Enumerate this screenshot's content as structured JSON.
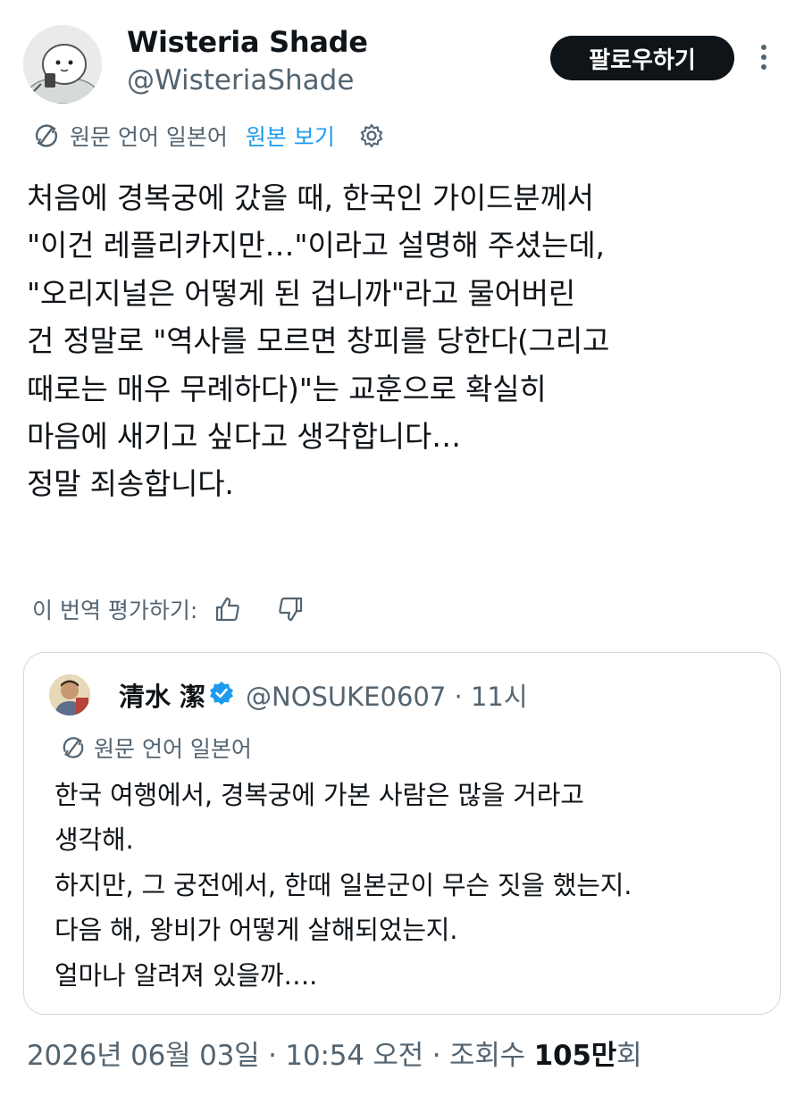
{
  "author": {
    "display_name": "Wisteria Shade",
    "handle": "@WisteriaShade",
    "avatar_icon": "cartoon-character-avatar"
  },
  "actions": {
    "follow_label": "팔로우하기",
    "more_icon": "more-vertical-icon"
  },
  "translation": {
    "source_language_label": "원문 언어 일본어",
    "show_original_label": "원본 보기",
    "settings_icon": "gear-icon",
    "rate_label": "이 번역 평가하기:",
    "thumbs_up_icon": "thumbs-up-icon",
    "thumbs_down_icon": "thumbs-down-icon"
  },
  "tweet": {
    "lines": [
      "처음에 경복궁에 갔을 때, 한국인 가이드분께서",
      "\"이건 레플리카지만…\"이라고 설명해 주셨는데,",
      "\"오리지널은 어떻게 된 겁니까\"라고 물어버린",
      "건 정말로 \"역사를 모르면 창피를 당한다(그리고",
      "때로는 매우 무례하다)\"는 교훈으로 확실히",
      "마음에 새기고 싶다고 생각합니다…",
      "정말 죄송합니다."
    ]
  },
  "quoted_tweet": {
    "display_name": "清水 潔",
    "verified_icon": "verified-badge-icon",
    "handle_time": "@NOSUKE0607 · 11시",
    "source_language_label": "원문 언어 일본어",
    "lines": [
      "한국 여행에서, 경복궁에 가본 사람은 많을 거라고",
      "생각해.",
      "하지만, 그 궁전에서, 한때 일본군이 무슨 짓을 했는지.",
      "다음 해, 왕비가 어떻게 살해되었는지.",
      "얼마나 알려져 있을까…."
    ]
  },
  "meta": {
    "date_time": "2026년 06월 03일 · 10:54 오전 · 조회수 ",
    "views_number": "105만",
    "views_suffix": "회"
  },
  "colors": {
    "text_primary": "#0f1419",
    "text_secondary": "#536471",
    "link": "#1d9bf0",
    "button_bg": "#0f1419",
    "border": "#cfd9de"
  }
}
